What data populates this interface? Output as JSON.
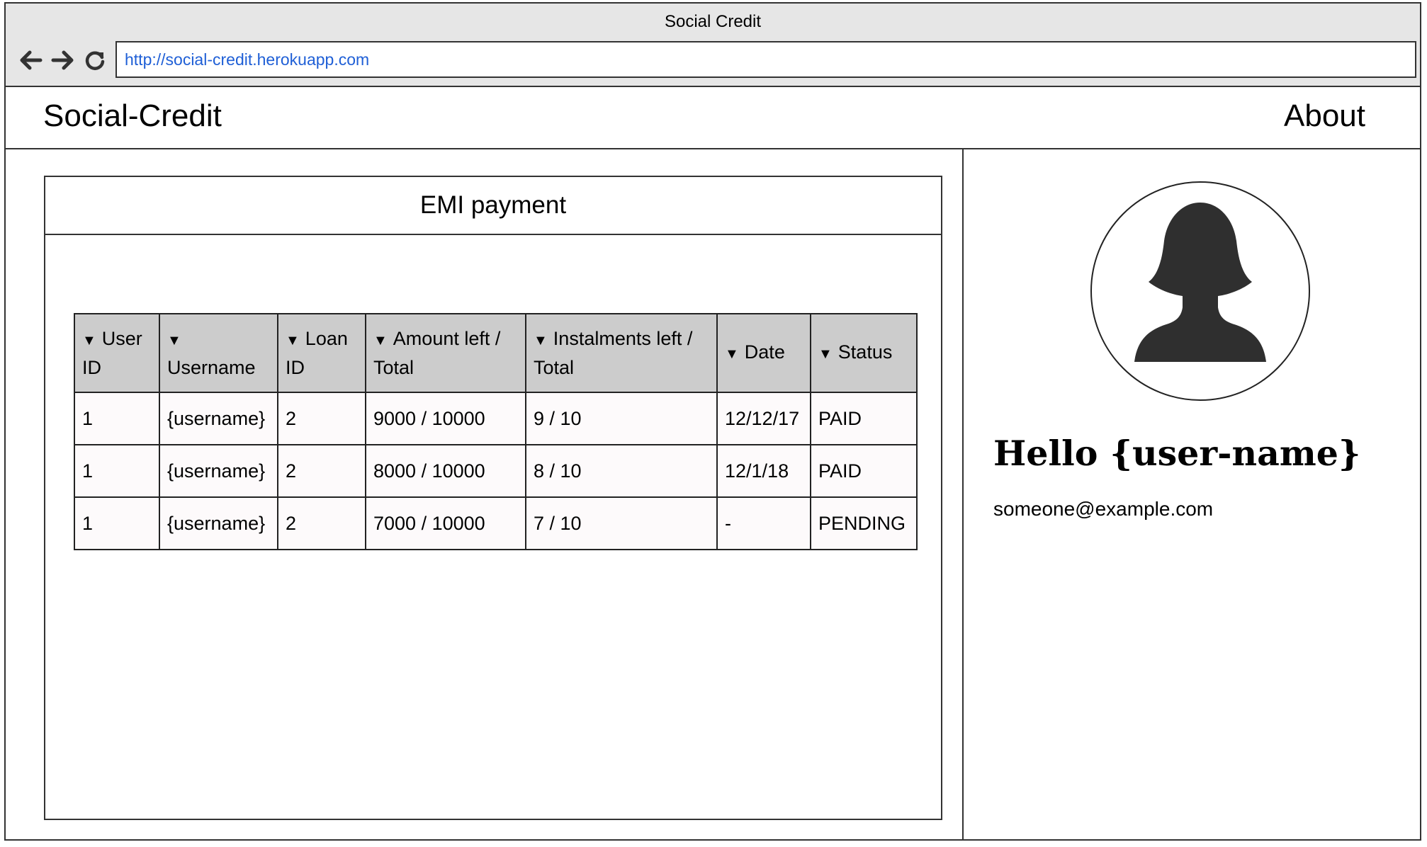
{
  "window": {
    "title": "Social Credit"
  },
  "browser": {
    "url": "http://social-credit.herokuapp.com"
  },
  "navbar": {
    "brand": "Social-Credit",
    "about": "About"
  },
  "panel": {
    "title": "EMI payment",
    "table": {
      "headers": [
        {
          "line1": "User",
          "line2": "ID"
        },
        {
          "line1": "",
          "line2": "Username"
        },
        {
          "line1": "Loan",
          "line2": "ID"
        },
        {
          "line1": "Amount left /",
          "line2": "Total"
        },
        {
          "line1": "Instalments left /",
          "line2": "Total"
        },
        {
          "line1": "Date",
          "line2": ""
        },
        {
          "line1": "Status",
          "line2": ""
        }
      ],
      "rows": [
        [
          "1",
          "{username}",
          "2",
          "9000 / 10000",
          "9 / 10",
          "12/12/17",
          "PAID"
        ],
        [
          "1",
          "{username}",
          "2",
          "8000 / 10000",
          "8 / 10",
          "12/1/18",
          "PAID"
        ],
        [
          "1",
          "{username}",
          "2",
          "7000 / 10000",
          "7 / 10",
          "-",
          "PENDING"
        ]
      ]
    }
  },
  "profile": {
    "greeting": "Hello {user-name}",
    "email": "someone@example.com",
    "avatar_icon": "user-silhouette-icon"
  },
  "icons": {
    "back": "arrow-left-icon",
    "forward": "arrow-right-icon",
    "reload": "refresh-icon",
    "sort": "triangle-down-icon"
  },
  "colors": {
    "titlebar": "#e6e6e6",
    "url_text": "#1f5fd6",
    "table_header": "#cccccc",
    "table_cell": "#fdfafb",
    "silhouette": "#2f2f2f"
  }
}
